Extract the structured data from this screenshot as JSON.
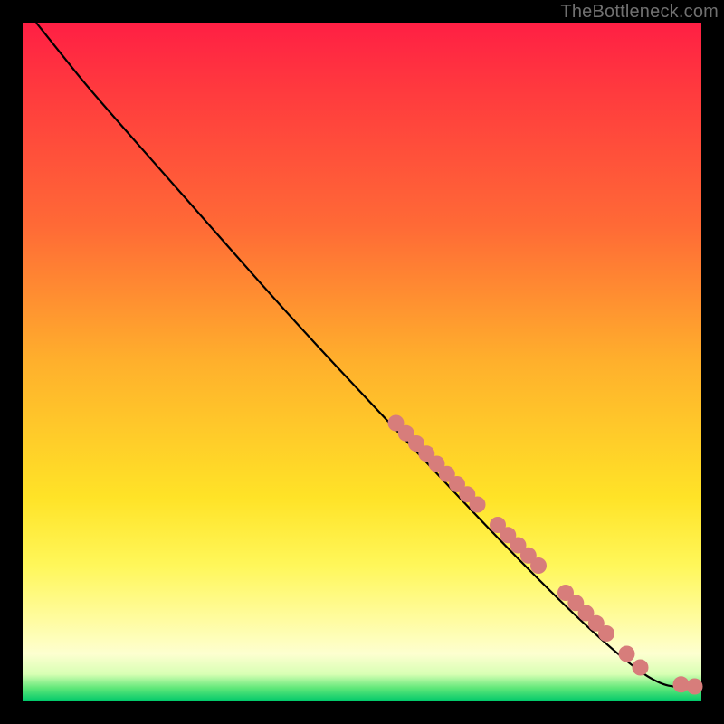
{
  "watermark": "TheBottleneck.com",
  "chart_data": {
    "type": "line",
    "title": "",
    "xlabel": "",
    "ylabel": "",
    "xlim": [
      0,
      100
    ],
    "ylim": [
      0,
      100
    ],
    "grid": false,
    "legend": false,
    "curve_xy": [
      [
        2,
        100
      ],
      [
        6,
        95
      ],
      [
        10,
        90
      ],
      [
        25,
        73
      ],
      [
        40,
        56
      ],
      [
        55,
        40
      ],
      [
        70,
        24
      ],
      [
        82,
        12
      ],
      [
        90,
        5
      ],
      [
        94,
        2.5
      ],
      [
        97,
        2
      ],
      [
        99,
        2
      ]
    ],
    "series": [
      {
        "name": "markers",
        "color": "#d77d7b",
        "points_xy": [
          [
            55,
            41
          ],
          [
            56.5,
            39.5
          ],
          [
            58,
            38
          ],
          [
            59.5,
            36.5
          ],
          [
            61,
            35
          ],
          [
            62.5,
            33.5
          ],
          [
            64,
            32
          ],
          [
            65.5,
            30.5
          ],
          [
            67,
            29
          ],
          [
            70,
            26
          ],
          [
            71.5,
            24.5
          ],
          [
            73,
            23
          ],
          [
            74.5,
            21.5
          ],
          [
            76,
            20
          ],
          [
            80,
            16
          ],
          [
            81.5,
            14.5
          ],
          [
            83,
            13
          ],
          [
            84.5,
            11.5
          ],
          [
            86,
            10
          ],
          [
            89,
            7
          ],
          [
            91,
            5
          ],
          [
            97,
            2.5
          ],
          [
            99,
            2.2
          ]
        ]
      }
    ]
  }
}
